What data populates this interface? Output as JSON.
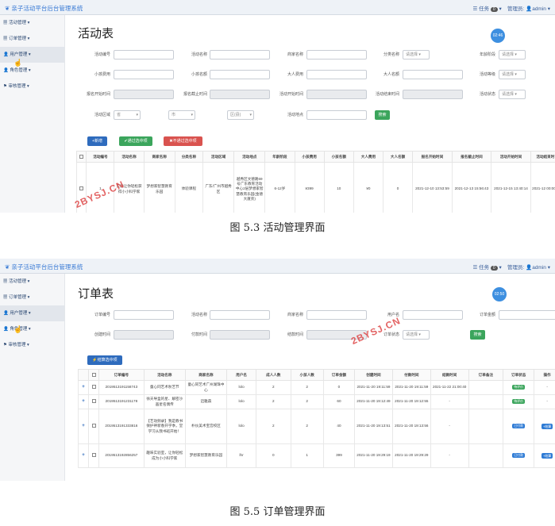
{
  "app_title": "亲子活动平台后台管理系统",
  "topbar": {
    "tasks_label": "任务",
    "tasks_count": "0",
    "admin_label": "管理员:",
    "admin_name": "admin"
  },
  "sidebar": {
    "items": [
      "活动管理",
      "订单管理",
      "用户管理",
      "角色管理",
      "审核管理"
    ]
  },
  "shot1": {
    "title": "活动表",
    "clock": "02:46",
    "filters": {
      "row1": [
        "活动编号",
        "活动名称",
        "商家名称",
        "分类名称",
        "年龄阶段"
      ],
      "row2": [
        "小孩费用",
        "小孩名额",
        "大人费用",
        "大人名额",
        "活动等级"
      ],
      "row3": [
        "报名开始时间",
        "报名截止时间",
        "活动开始时间",
        "活动结束时间",
        "活动状态"
      ],
      "row4_region": "活动区域",
      "row4_place": "活动地点",
      "select_placeholder": "请选择",
      "province": "省",
      "city": "市",
      "district": "区(县)",
      "search": "搜索"
    },
    "buttons": {
      "add": "+新增",
      "pass": "✔通过选中项",
      "reject": "✖不通过选中项"
    },
    "table": {
      "headers": [
        "",
        "活动编号",
        "活动名称",
        "商家名称",
        "分类名称",
        "活动区域",
        "活动地点",
        "年龄阶段",
        "小孩费用",
        "小孩名额",
        "大人费用",
        "大人名额",
        "报名开始时间",
        "报名截止时间",
        "活动开始时间",
        "活动结束时"
      ],
      "row": [
        "",
        "1",
        "实验让你轻松获得小小科学家",
        "梦想家智慧教育乐园",
        "体验课程",
        "广东/广州市越秀区",
        "越秀区文德路69号广东教育活动中心2层梦想家智慧教育乐园(金德大厦旁)",
        "6-12岁",
        "¥399",
        "10",
        "¥0",
        "0",
        "2021-12-10 13:53:59",
        "2021-12-13 15:56:43",
        "2021-12-15 13:40:14",
        "2021-12 00:00:0"
      ]
    },
    "caption": "图 5.3 活动管理界面"
  },
  "shot2": {
    "title": "订单表",
    "clock": "02:50",
    "filters": {
      "row1": [
        "订单编号",
        "活动名称",
        "商家名称",
        "用户名",
        "订单金额"
      ],
      "row2": [
        "创建时间",
        "付款时间",
        "结款时间",
        "订单状态"
      ],
      "select_placeholder": "请选择",
      "search": "搜索"
    },
    "buttons": {
      "settle": "⚡结算选中项"
    },
    "table": {
      "headers": [
        "",
        "",
        "订单编号",
        "活动名称",
        "商家名称",
        "用户名",
        "成人人数",
        "小孩人数",
        "订单金额",
        "创建时间",
        "付款时间",
        "结款时间",
        "订单备注",
        "订单状态",
        "操作"
      ],
      "rows": [
        [
          "+",
          "",
          "2019513191158743",
          "童心同艺术秋艺节",
          "童心同艺术广州湖珠中心",
          "lolo",
          "2",
          "2",
          "0",
          "2021-11-20 19:11:59",
          "2021-11-20 19:11:59",
          "2021-11-22 21:00:40",
          "",
          "待评价",
          "-"
        ],
        [
          "+",
          "",
          "2019513191231178",
          "徐天导盒的星、解密沙画星名偶传",
          "迈雅森",
          "lolo",
          "2",
          "2",
          "60",
          "2021-11-20 19:12:49",
          "2021-11-20 19:12:55",
          "-",
          "",
          "待评价",
          "-"
        ],
        [
          "+",
          "",
          "2019513191333816",
          "【艺动频录】我是教书保护神新春开学季，堂学习从我书班开始！",
          "朴伙美术宝宫校区",
          "lolo",
          "2",
          "2",
          "40",
          "2021-11-20 19:13:51",
          "2021-11-20 19:13:56",
          "-",
          "",
          "已付款",
          "+结算"
        ],
        [
          "+",
          "",
          "2019513192856257",
          "趣味实验室，让你轻松成为小小科学家",
          "梦想家智慧教育乐园",
          "lhr",
          "0",
          "1",
          "399",
          "2021-11-20 19:29:19",
          "2021-11-20 19:29:29",
          "-",
          "",
          "已付款",
          "+结算"
        ]
      ]
    },
    "caption": "图 5.5 订单管理界面"
  },
  "watermark": "2BYSJ.CN"
}
